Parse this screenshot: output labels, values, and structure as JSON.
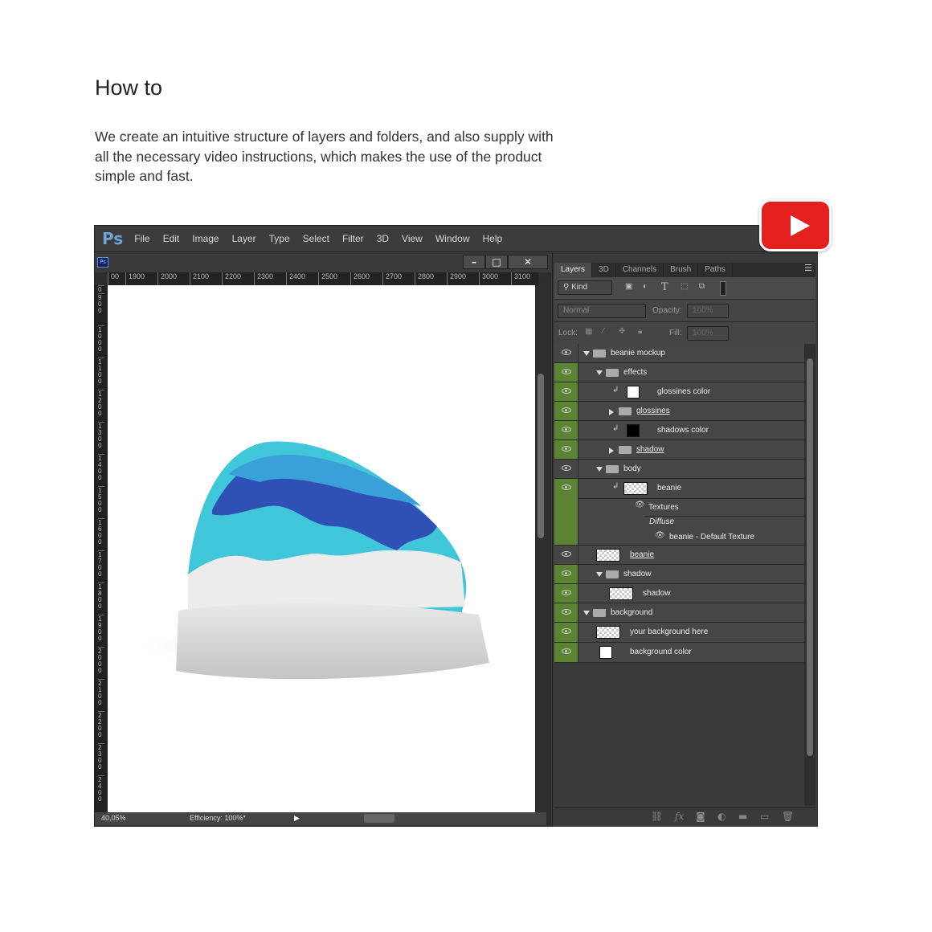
{
  "heading": "How to",
  "description": "We create an intuitive structure of layers and folders, and also supply with all the necessary video instructions, which makes the use of the product simple and fast.",
  "youtube_icon": "youtube-play-icon",
  "accent": {
    "youtube": "#e3201d",
    "layer_visible": "#5b8432"
  },
  "app": {
    "logo": "Ps",
    "menu": [
      "File",
      "Edit",
      "Image",
      "Layer",
      "Type",
      "Select",
      "Filter",
      "3D",
      "View",
      "Window",
      "Help"
    ]
  },
  "document": {
    "icon_label": "Ps",
    "window_buttons": [
      "minimize",
      "maximize",
      "close"
    ],
    "hruler": [
      "00",
      "1900",
      "2000",
      "2100",
      "2200",
      "2300",
      "2400",
      "2500",
      "2600",
      "2700",
      "2800",
      "2900",
      "3000",
      "3100"
    ],
    "vruler": [
      "0",
      "900",
      "1000",
      "1100",
      "1200",
      "1300",
      "1400",
      "1500",
      "1600",
      "1700",
      "1800",
      "1900",
      "2000",
      "2100",
      "2200",
      "2300",
      "2400"
    ],
    "zoom": "40,05%",
    "status": "Efficiency: 100%*"
  },
  "panel": {
    "tabs": [
      "Layers",
      "3D",
      "Channels",
      "Brush",
      "Paths"
    ],
    "filter": "Kind",
    "blend_mode": "Normal",
    "opacity_label": "Opacity:",
    "opacity": "100%",
    "lock_label": "Lock:",
    "fill_label": "Fill:",
    "fill": "100%",
    "layers": [
      {
        "name": "beanie mockup",
        "type": "group",
        "open": true,
        "visible_highlight": false
      },
      {
        "name": "effects",
        "type": "group",
        "open": true,
        "visible_highlight": true
      },
      {
        "name": "glossines color",
        "type": "fill-white",
        "clipped": true,
        "visible_highlight": true
      },
      {
        "name": "glossines",
        "type": "group",
        "open": false,
        "linked": true,
        "visible_highlight": true
      },
      {
        "name": "shadows color",
        "type": "fill-black",
        "clipped": true,
        "visible_highlight": true
      },
      {
        "name": "shadow",
        "type": "group",
        "open": false,
        "linked": true,
        "visible_highlight": true
      },
      {
        "name": "body",
        "type": "group",
        "open": true,
        "visible_highlight": false
      },
      {
        "name": "beanie",
        "type": "3d",
        "clipped": true,
        "visible_highlight": true,
        "textures": "Textures",
        "diffuse": "Diffuse",
        "texture": "beanie - Default Texture"
      },
      {
        "name": "beanie",
        "type": "smart",
        "linked": true,
        "visible_highlight": false
      },
      {
        "name": "shadow",
        "type": "group",
        "open": true,
        "visible_highlight": true
      },
      {
        "name": "shadow",
        "type": "smart",
        "visible_highlight": true
      },
      {
        "name": "background",
        "type": "group",
        "open": true,
        "visible_highlight": true
      },
      {
        "name": "your background here",
        "type": "transparent",
        "visible_highlight": true
      },
      {
        "name": "background color",
        "type": "fill-white",
        "visible_highlight": true
      }
    ]
  }
}
